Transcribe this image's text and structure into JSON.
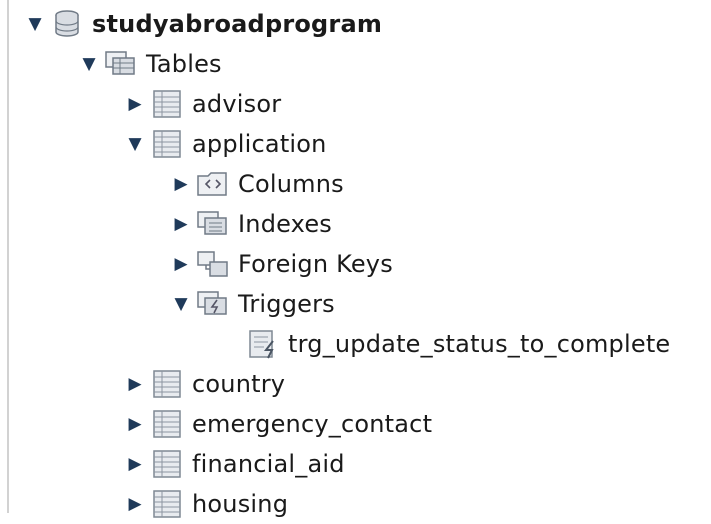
{
  "tree": {
    "schema": {
      "label": "studyabroadprogram",
      "expanded": true,
      "icon": "database-icon"
    },
    "tables_group": {
      "label": "Tables",
      "expanded": true,
      "icon": "tables-folder-icon"
    },
    "tables": [
      {
        "label": "advisor",
        "expanded": false,
        "icon": "table-icon"
      },
      {
        "label": "application",
        "expanded": true,
        "icon": "table-icon"
      },
      {
        "label": "country",
        "expanded": false,
        "icon": "table-icon"
      },
      {
        "label": "emergency_contact",
        "expanded": false,
        "icon": "table-icon"
      },
      {
        "label": "financial_aid",
        "expanded": false,
        "icon": "table-icon"
      },
      {
        "label": "housing",
        "expanded": false,
        "icon": "table-icon"
      }
    ],
    "application_children": [
      {
        "label": "Columns",
        "expanded": false,
        "icon": "columns-folder-icon"
      },
      {
        "label": "Indexes",
        "expanded": false,
        "icon": "indexes-folder-icon"
      },
      {
        "label": "Foreign Keys",
        "expanded": false,
        "icon": "foreign-keys-folder-icon"
      },
      {
        "label": "Triggers",
        "expanded": true,
        "icon": "triggers-folder-icon"
      }
    ],
    "trigger": {
      "label": "trg_update_status_to_complete",
      "icon": "trigger-icon"
    }
  },
  "colors": {
    "expander": "#1f3a5a",
    "text": "#1a1a1a",
    "icon_fill": "#d9dde3",
    "icon_stroke": "#707a86"
  },
  "glyphs": {
    "expanded": "▼",
    "collapsed": "▶"
  }
}
